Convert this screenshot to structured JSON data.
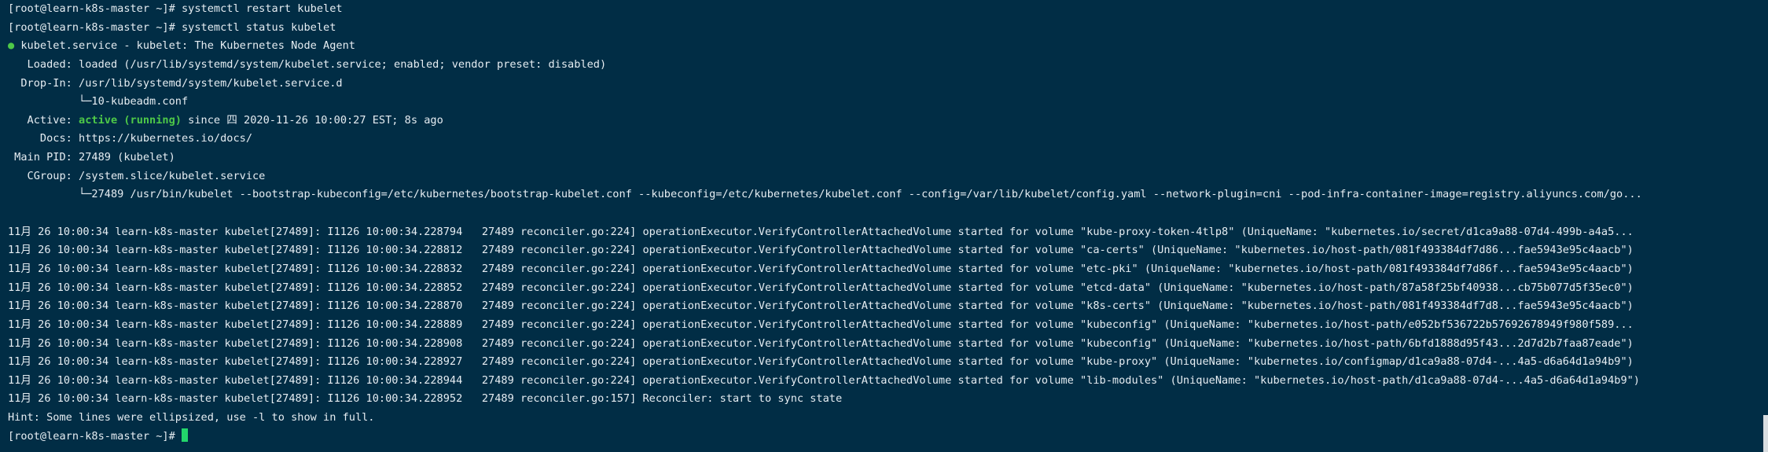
{
  "colors": {
    "background": "#012d45",
    "text": "#e6edf2",
    "status_green": "#4ec948",
    "cursor": "#22d66b"
  },
  "lines": [
    {
      "text": "[root@learn-k8s-master ~]# systemctl restart kubelet"
    },
    {
      "text": "[root@learn-k8s-master ~]# systemctl status kubelet"
    },
    {
      "text": " kubelet.service - kubelet: The Kubernetes Node Agent",
      "bullet": "●"
    },
    {
      "text": "   Loaded: loaded (/usr/lib/systemd/system/kubelet.service; enabled; vendor preset: disabled)"
    },
    {
      "text": "  Drop-In: /usr/lib/systemd/system/kubelet.service.d"
    },
    {
      "text": "           └─10-kubeadm.conf"
    },
    {
      "prefix": "   Active: ",
      "highlight": "active (running)",
      "suffix": " since 四 2020-11-26 10:00:27 EST; 8s ago"
    },
    {
      "text": "     Docs: https://kubernetes.io/docs/"
    },
    {
      "text": " Main PID: 27489 (kubelet)"
    },
    {
      "text": "   CGroup: /system.slice/kubelet.service"
    },
    {
      "text": "           └─27489 /usr/bin/kubelet --bootstrap-kubeconfig=/etc/kubernetes/bootstrap-kubelet.conf --kubeconfig=/etc/kubernetes/kubelet.conf --config=/var/lib/kubelet/config.yaml --network-plugin=cni --pod-infra-container-image=registry.aliyuncs.com/go..."
    },
    {
      "text": ""
    },
    {
      "text": "11月 26 10:00:34 learn-k8s-master kubelet[27489]: I1126 10:00:34.228794   27489 reconciler.go:224] operationExecutor.VerifyControllerAttachedVolume started for volume \"kube-proxy-token-4tlp8\" (UniqueName: \"kubernetes.io/secret/d1ca9a88-07d4-499b-a4a5..."
    },
    {
      "text": "11月 26 10:00:34 learn-k8s-master kubelet[27489]: I1126 10:00:34.228812   27489 reconciler.go:224] operationExecutor.VerifyControllerAttachedVolume started for volume \"ca-certs\" (UniqueName: \"kubernetes.io/host-path/081f493384df7d86...fae5943e95c4aacb\")"
    },
    {
      "text": "11月 26 10:00:34 learn-k8s-master kubelet[27489]: I1126 10:00:34.228832   27489 reconciler.go:224] operationExecutor.VerifyControllerAttachedVolume started for volume \"etc-pki\" (UniqueName: \"kubernetes.io/host-path/081f493384df7d86f...fae5943e95c4aacb\")"
    },
    {
      "text": "11月 26 10:00:34 learn-k8s-master kubelet[27489]: I1126 10:00:34.228852   27489 reconciler.go:224] operationExecutor.VerifyControllerAttachedVolume started for volume \"etcd-data\" (UniqueName: \"kubernetes.io/host-path/87a58f25bf40938...cb75b077d5f35ec0\")"
    },
    {
      "text": "11月 26 10:00:34 learn-k8s-master kubelet[27489]: I1126 10:00:34.228870   27489 reconciler.go:224] operationExecutor.VerifyControllerAttachedVolume started for volume \"k8s-certs\" (UniqueName: \"kubernetes.io/host-path/081f493384df7d8...fae5943e95c4aacb\")"
    },
    {
      "text": "11月 26 10:00:34 learn-k8s-master kubelet[27489]: I1126 10:00:34.228889   27489 reconciler.go:224] operationExecutor.VerifyControllerAttachedVolume started for volume \"kubeconfig\" (UniqueName: \"kubernetes.io/host-path/e052bf536722b57692678949f980f589..."
    },
    {
      "text": "11月 26 10:00:34 learn-k8s-master kubelet[27489]: I1126 10:00:34.228908   27489 reconciler.go:224] operationExecutor.VerifyControllerAttachedVolume started for volume \"kubeconfig\" (UniqueName: \"kubernetes.io/host-path/6bfd1888d95f43...2d7d2b7faa87eade\")"
    },
    {
      "text": "11月 26 10:00:34 learn-k8s-master kubelet[27489]: I1126 10:00:34.228927   27489 reconciler.go:224] operationExecutor.VerifyControllerAttachedVolume started for volume \"kube-proxy\" (UniqueName: \"kubernetes.io/configmap/d1ca9a88-07d4-...4a5-d6a64d1a94b9\")"
    },
    {
      "text": "11月 26 10:00:34 learn-k8s-master kubelet[27489]: I1126 10:00:34.228944   27489 reconciler.go:224] operationExecutor.VerifyControllerAttachedVolume started for volume \"lib-modules\" (UniqueName: \"kubernetes.io/host-path/d1ca9a88-07d4-...4a5-d6a64d1a94b9\")"
    },
    {
      "text": "11月 26 10:00:34 learn-k8s-master kubelet[27489]: I1126 10:00:34.228952   27489 reconciler.go:157] Reconciler: start to sync state"
    },
    {
      "text": "Hint: Some lines were ellipsized, use -l to show in full."
    }
  ],
  "prompt": "[root@learn-k8s-master ~]# "
}
